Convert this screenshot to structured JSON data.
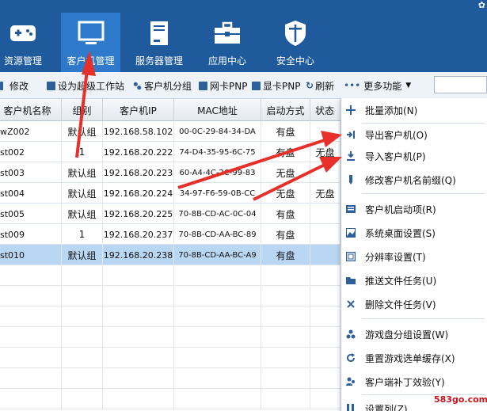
{
  "nav": {
    "items": [
      {
        "label": "资源管理",
        "icon": "gamepad-icon"
      },
      {
        "label": "客户机管理",
        "icon": "monitor-icon",
        "active": true
      },
      {
        "label": "服务器管理",
        "icon": "server-icon"
      },
      {
        "label": "应用中心",
        "icon": "toolbox-icon"
      },
      {
        "label": "安全中心",
        "icon": "shield-icon"
      }
    ],
    "active_color": "#2e79c9",
    "bar_color": "#1f5a9c"
  },
  "toolbar": {
    "edit": "修改",
    "set_super": "设为超级工作站",
    "group": "客户机分组",
    "nic_pnp": "网卡PNP",
    "gpu_pnp": "显卡PNP",
    "refresh": "刷新",
    "more": "更多功能"
  },
  "table": {
    "headers": [
      "客户机名称",
      "组别",
      "客户机IP",
      "MAC地址",
      "启动方式",
      "状态"
    ],
    "rows": [
      {
        "name": "wZ002",
        "group": "默认组",
        "ip": "192.168.58.102",
        "mac": "00-0C-29-84-34-DA",
        "boot": "有盘",
        "status": ""
      },
      {
        "name": "st002",
        "group": "1",
        "ip": "192.168.20.222",
        "mac": "74-D4-35-95-6C-75",
        "boot": "有盘",
        "status": "无盘"
      },
      {
        "name": "st003",
        "group": "默认组",
        "ip": "192.168.20.223",
        "mac": "60-A4-4C-2C-99-83",
        "boot": "无盘",
        "status": ""
      },
      {
        "name": "st004",
        "group": "默认组",
        "ip": "192.168.20.224",
        "mac": "34-97-F6-59-0B-CC",
        "boot": "无盘",
        "status": "无盘"
      },
      {
        "name": "st005",
        "group": "默认组",
        "ip": "192.168.20.225",
        "mac": "70-8B-CD-AC-0C-04",
        "boot": "有盘",
        "status": ""
      },
      {
        "name": "st009",
        "group": "1",
        "ip": "192.168.20.237",
        "mac": "70-8B-CD-AA-BC-89",
        "boot": "有盘",
        "status": ""
      },
      {
        "name": "st010",
        "group": "默认组",
        "ip": "192.168.20.238",
        "mac": "70-8B-CD-AA-BC-A9",
        "boot": "有盘",
        "status": "",
        "selected": true
      }
    ]
  },
  "menu": {
    "items": [
      {
        "label": "批量添加(N)",
        "icon": "batch-add-icon"
      },
      {
        "label": "导出客户机(O)",
        "icon": "export-icon"
      },
      {
        "label": "导入客户机(P)",
        "icon": "import-icon"
      },
      {
        "label": "修改客户机名前缀(Q)",
        "icon": "edit-prefix-icon"
      },
      {
        "label": "客户机启动项(R)",
        "icon": "startup-list-icon"
      },
      {
        "label": "系统桌面设置(S)",
        "icon": "desktop-image-icon"
      },
      {
        "label": "分辨率设置(T)",
        "icon": "resolution-icon"
      },
      {
        "label": "推送文件任务(U)",
        "icon": "folder-icon"
      },
      {
        "label": "删除文件任务(V)",
        "icon": "delete-icon"
      },
      {
        "label": "游戏盘分组设置(W)",
        "icon": "dots-group-icon"
      },
      {
        "label": "重置游戏选单缓存(X)",
        "icon": "reset-icon"
      },
      {
        "label": "客户端补丁效验(Y)",
        "icon": "patch-icon"
      },
      {
        "label": "设置列(Z)",
        "icon": "columns-icon"
      }
    ]
  },
  "watermark": "583go.com",
  "accent_red": "#e8302a"
}
